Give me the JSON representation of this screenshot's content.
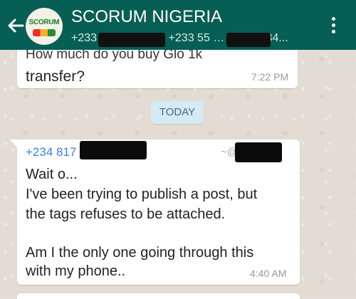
{
  "header": {
    "title": "SCORUM NIGERIA",
    "subtitle": "+233 24 4… 2083, +233 55 … 245, +234...",
    "avatar_text": "SCORUM"
  },
  "messages": {
    "previous": {
      "line1": "How much do you buy Glo 1k",
      "line2": "transfer?",
      "time": "7:22 PM"
    },
    "date_divider": "TODAY",
    "current": {
      "sender_phone": "+234 817",
      "sender_name": "~@",
      "lines": [
        "Wait o...",
        "I've been trying to publish a post, but",
        "the tags refuses to be attached.",
        "",
        "Am I the only one going through this",
        "with my phone.."
      ],
      "time": "4:40 AM"
    }
  },
  "icons": {
    "back": "arrow-left-icon",
    "menu": "more-vertical-icon"
  },
  "colors": {
    "header": "#075e54",
    "sender": "#3f7fd0",
    "date_pill": "#d4eaf4"
  }
}
